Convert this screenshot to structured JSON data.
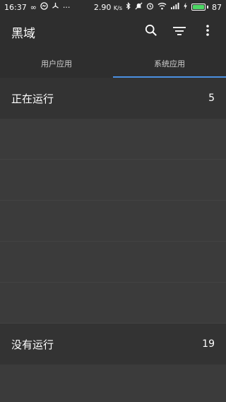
{
  "status_bar": {
    "time": "16:37",
    "speed": "2.90",
    "speed_unit": "K/s",
    "battery": "87",
    "icons": [
      "infinity-icon",
      "messenger-icon",
      "network-icon",
      "more-dots-icon",
      "bluetooth-icon",
      "mute-icon",
      "alarm-icon",
      "wifi-icon",
      "signal-icon",
      "charging-icon"
    ]
  },
  "app_bar": {
    "title": "黑域",
    "icons": [
      "search-icon",
      "sort-icon",
      "overflow-menu-icon"
    ]
  },
  "tabs": [
    {
      "label": "用户应用",
      "active": false
    },
    {
      "label": "系统应用",
      "active": true
    }
  ],
  "running_section": {
    "title": "正在运行",
    "count": "5"
  },
  "stopped_section": {
    "title": "没有运行",
    "count": "19"
  },
  "colors": {
    "accent": "#4a90e2",
    "battery": "#4cd964",
    "bar_background": "#2e2e2e",
    "content_background": "#3b3b3b"
  }
}
